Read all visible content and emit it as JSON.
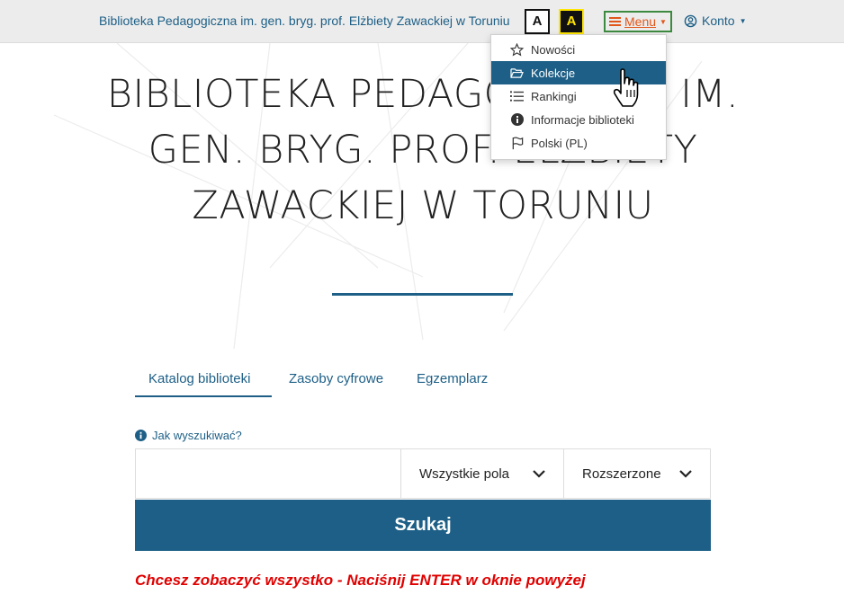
{
  "header": {
    "library_name": "Biblioteka Pedagogiczna im. gen. bryg. prof. Elżbiety Zawackiej w Toruniu",
    "contrast_normal": "A",
    "contrast_high": "A",
    "menu_label": "Menu",
    "account_label": "Konto"
  },
  "hero": {
    "title": "BIBLIOTEKA PEDAGOGICZNA IM. GEN. BRYG. PROF. ELŻBIETY ZAWACKIEJ W TORUNIU"
  },
  "tabs": [
    {
      "label": "Katalog biblioteki",
      "active": true
    },
    {
      "label": "Zasoby cyfrowe",
      "active": false
    },
    {
      "label": "Egzemplarz",
      "active": false
    }
  ],
  "search": {
    "help_link": "Jak wyszukiwać?",
    "input_value": "",
    "field_select": "Wszystkie pola",
    "mode_select": "Rozszerzone",
    "button_label": "Szukaj",
    "hint": "Chcesz zobaczyć wszystko - Naciśnij ENTER w oknie powyżej"
  },
  "menu_dropdown": {
    "items": [
      {
        "label": "Nowości",
        "icon": "star-icon"
      },
      {
        "label": "Kolekcje",
        "icon": "folder-open-icon",
        "active": true
      },
      {
        "label": "Rankingi",
        "icon": "list-ordered-icon"
      },
      {
        "label": "Informacje biblioteki",
        "icon": "info-icon"
      },
      {
        "label": "Polski (PL)",
        "icon": "flag-icon"
      }
    ]
  },
  "colors": {
    "brand": "#1d5f86",
    "menu_text": "#e2561a",
    "menu_border": "#3c8a3f",
    "hint_text": "#e00000",
    "topbar_bg": "#ececec"
  }
}
